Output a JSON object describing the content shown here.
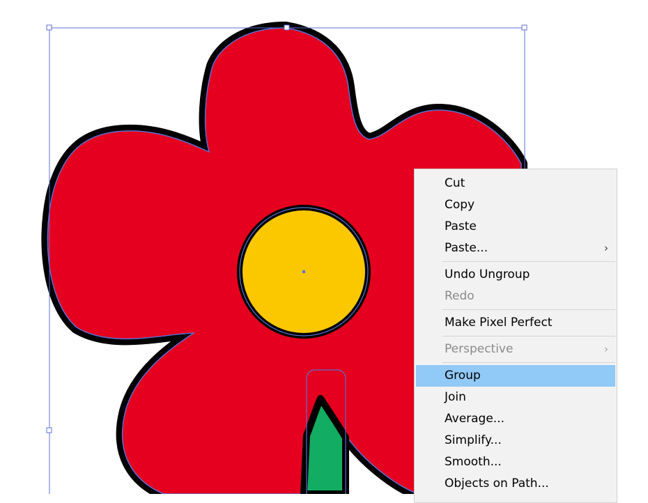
{
  "canvas": {
    "selection_color": "#5b6fd6",
    "petal_color": "#e4001e",
    "center_color": "#fbc800",
    "stem_color": "#12ac62",
    "outline_color": "#000000"
  },
  "context_menu": {
    "items": [
      {
        "label": "Cut",
        "enabled": true,
        "submenu": false
      },
      {
        "label": "Copy",
        "enabled": true,
        "submenu": false
      },
      {
        "label": "Paste",
        "enabled": true,
        "submenu": false
      },
      {
        "label": "Paste...",
        "enabled": true,
        "submenu": true,
        "arrow": "›"
      },
      {
        "label": "Undo Ungroup",
        "enabled": true,
        "submenu": false
      },
      {
        "label": "Redo",
        "enabled": false,
        "submenu": false
      },
      {
        "label": "Make Pixel Perfect",
        "enabled": true,
        "submenu": false
      },
      {
        "label": "Perspective",
        "enabled": false,
        "submenu": true,
        "arrow": "›"
      },
      {
        "label": "Group",
        "enabled": true,
        "submenu": false,
        "highlighted": true
      },
      {
        "label": "Join",
        "enabled": true,
        "submenu": false
      },
      {
        "label": "Average...",
        "enabled": true,
        "submenu": false
      },
      {
        "label": "Simplify...",
        "enabled": true,
        "submenu": false
      },
      {
        "label": "Smooth...",
        "enabled": true,
        "submenu": false
      },
      {
        "label": "Objects on Path...",
        "enabled": true,
        "submenu": false
      }
    ],
    "highlight_color": "#91c9f7"
  }
}
